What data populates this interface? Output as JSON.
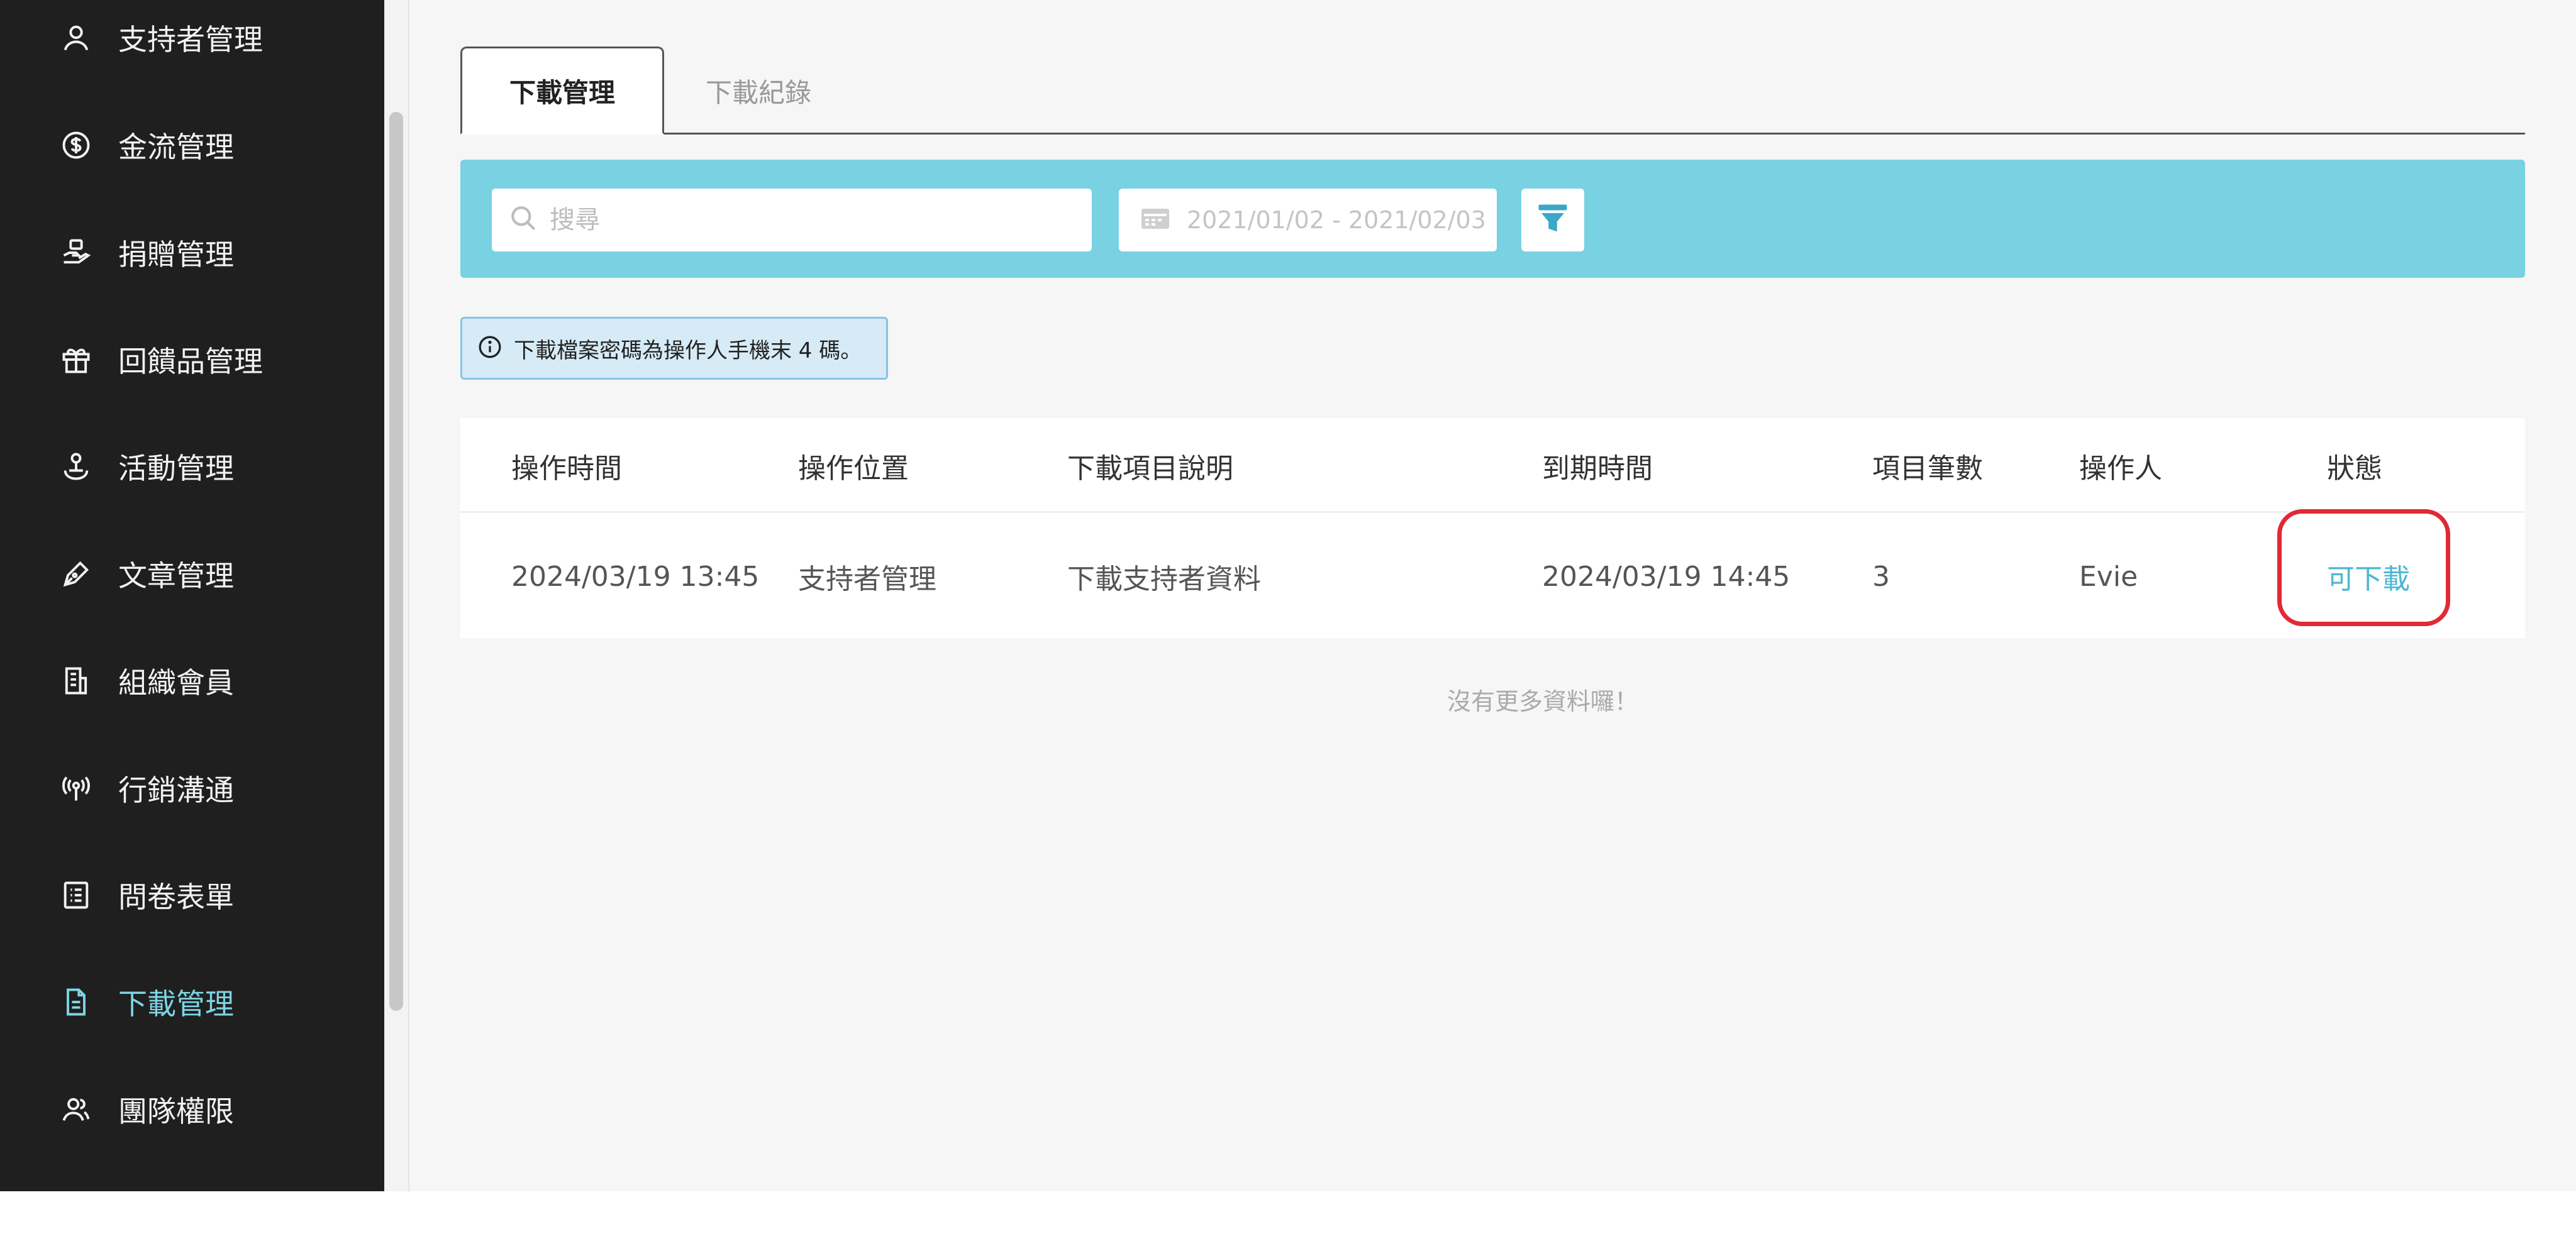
{
  "sidebar": {
    "items": [
      {
        "label": "支持者管理",
        "icon": "user-icon"
      },
      {
        "label": "金流管理",
        "icon": "dollar-circle-icon"
      },
      {
        "label": "捐贈管理",
        "icon": "donation-hand-icon"
      },
      {
        "label": "回饋品管理",
        "icon": "gift-icon"
      },
      {
        "label": "活動管理",
        "icon": "event-icon"
      },
      {
        "label": "文章管理",
        "icon": "pen-icon"
      },
      {
        "label": "組織會員",
        "icon": "building-icon"
      },
      {
        "label": "行銷溝通",
        "icon": "broadcast-icon"
      },
      {
        "label": "問卷表單",
        "icon": "list-form-icon"
      },
      {
        "label": "下載管理",
        "icon": "file-icon",
        "active": true
      },
      {
        "label": "團隊權限",
        "icon": "team-icon"
      }
    ],
    "active_color": "#7ed4e4"
  },
  "tabs": [
    {
      "label": "下載管理",
      "active": true
    },
    {
      "label": "下載紀錄",
      "active": false
    }
  ],
  "filters": {
    "search_placeholder": "搜尋",
    "date_range": "2021/01/02 - 2021/02/03",
    "bar_color": "#78d2e2"
  },
  "notice": {
    "text": "下載檔案密碼為操作人手機末 4 碼。"
  },
  "table": {
    "headers": [
      "操作時間",
      "操作位置",
      "下載項目說明",
      "到期時間",
      "項目筆數",
      "操作人",
      "狀態"
    ],
    "rows": [
      {
        "time": "2024/03/19 13:45",
        "location": "支持者管理",
        "description": "下載支持者資料",
        "expires": "2024/03/19 14:45",
        "count": "3",
        "operator": "Evie",
        "status": "可下載"
      }
    ]
  },
  "footer_note": "沒有更多資料囉！",
  "colors": {
    "status_link": "#4bb7d2",
    "highlight_border": "#e02a36"
  }
}
